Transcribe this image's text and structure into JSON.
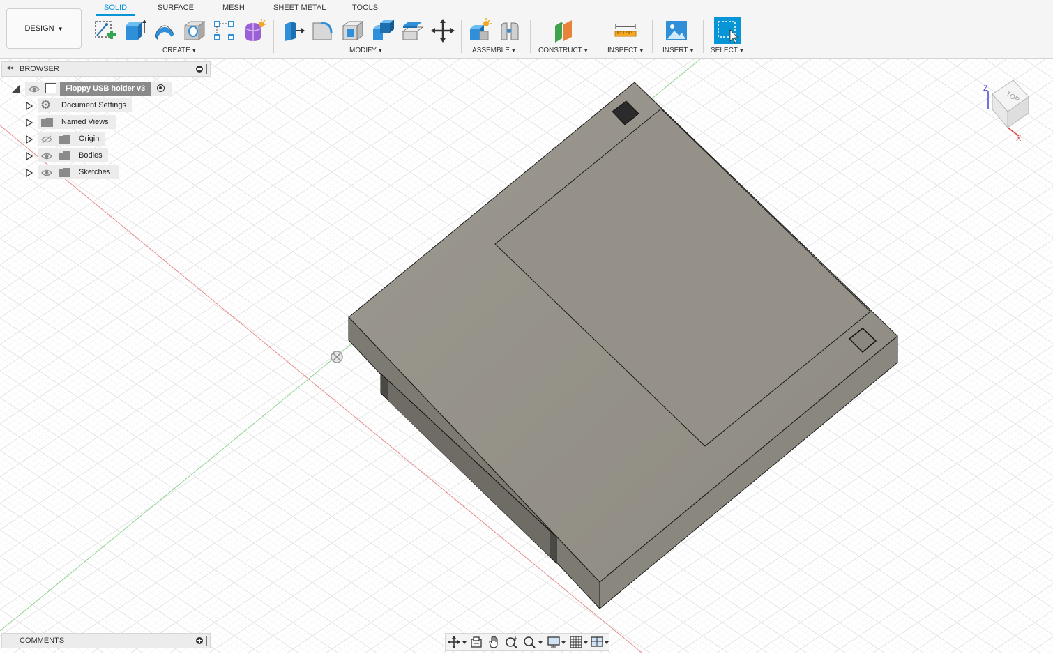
{
  "toolbar": {
    "workspace": "DESIGN",
    "tabs": [
      "SOLID",
      "SURFACE",
      "MESH",
      "SHEET METAL",
      "TOOLS"
    ],
    "active_tab": "SOLID",
    "groups": {
      "create": "CREATE",
      "modify": "MODIFY",
      "assemble": "ASSEMBLE",
      "construct": "CONSTRUCT",
      "inspect": "INSPECT",
      "insert": "INSERT",
      "select": "SELECT"
    }
  },
  "browser": {
    "title": "BROWSER",
    "root": "Floppy USB holder v3",
    "items": [
      "Document Settings",
      "Named Views",
      "Origin",
      "Bodies",
      "Sketches"
    ]
  },
  "comments": {
    "title": "COMMENTS"
  },
  "viewcube": {
    "face": "TOP",
    "axes": {
      "z": "Z",
      "x": "X"
    }
  },
  "icons": {
    "create": [
      "create-sketch-icon",
      "extrude-icon",
      "revolve-icon",
      "hole-icon",
      "pattern-icon",
      "create-form-icon"
    ],
    "modify": [
      "press-pull-icon",
      "fillet-icon",
      "shell-icon",
      "combine-icon",
      "offset-face-icon",
      "move-icon"
    ],
    "assemble": [
      "new-component-icon",
      "joint-icon"
    ],
    "construct": [
      "offset-plane-icon"
    ],
    "inspect": [
      "measure-icon"
    ],
    "insert": [
      "insert-image-icon"
    ],
    "select": [
      "select-icon"
    ],
    "nav": [
      "orbit-icon",
      "look-at-icon",
      "pan-icon",
      "zoom-icon",
      "fit-icon",
      "display-settings-icon",
      "grid-icon",
      "viewports-icon"
    ]
  },
  "colors": {
    "accent": "#0696d7",
    "body_top": "#9a968d",
    "body_front": "#7d7a72",
    "body_side": "#8a877f",
    "grid": "#e2e2e2",
    "x_axis": "#e06464",
    "y_axis": "#6cc46c"
  }
}
